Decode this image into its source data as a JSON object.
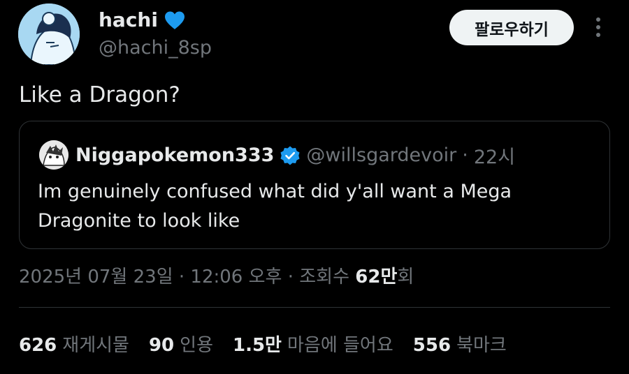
{
  "author": {
    "display_name": "hachi",
    "handle": "@hachi_8sp",
    "follow_label": "팔로우하기"
  },
  "tweet": {
    "text": "Like a Dragon?"
  },
  "quote": {
    "display_name": "Niggapokemon333",
    "handle": "@willsgardevoir",
    "separator": "·",
    "time": "22시",
    "text": "Im genuinely confused what did y'all want a Mega Dragonite to look like"
  },
  "meta": {
    "date": "2025년 07월 23일 · 12:06 오후 · 조회수 ",
    "views_number": "62만",
    "views_suffix": "회"
  },
  "stats": [
    {
      "number": "626",
      "label": "재게시물"
    },
    {
      "number": "90",
      "label": "인용"
    },
    {
      "number": "1.5만",
      "label": "마음에 들어요"
    },
    {
      "number": "556",
      "label": "북마크"
    }
  ],
  "colors": {
    "heart": "#1d9bf0",
    "verified": "#1d9bf0"
  }
}
